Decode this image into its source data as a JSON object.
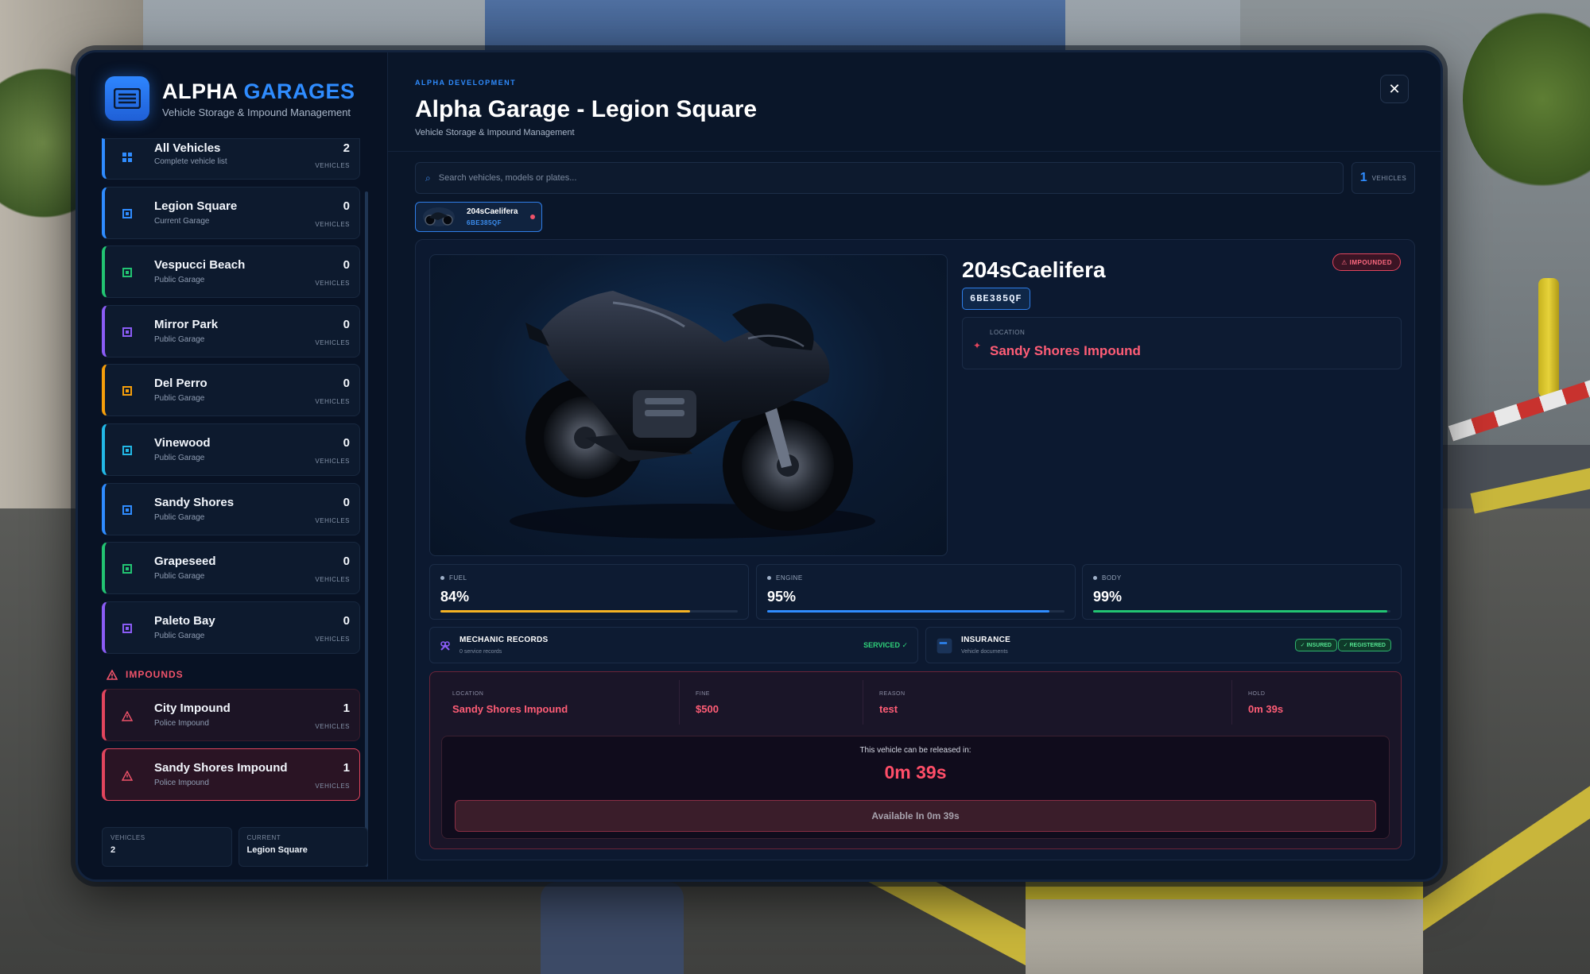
{
  "brand": {
    "title_main": "ALPHA",
    "title_accent": "GARAGES",
    "subtitle": "Vehicle Storage & Impound Management"
  },
  "sidebar": {
    "vehicles_unit": "VEHICLES",
    "garages": [
      {
        "name": "All Vehicles",
        "sub": "Complete vehicle list",
        "count": "2",
        "color": "#2f8cff"
      },
      {
        "name": "Legion Square",
        "sub": "Current Garage",
        "count": "0",
        "color": "#2f8cff"
      },
      {
        "name": "Vespucci Beach",
        "sub": "Public Garage",
        "count": "0",
        "color": "#22c472"
      },
      {
        "name": "Mirror Park",
        "sub": "Public Garage",
        "count": "0",
        "color": "#8b5cf6"
      },
      {
        "name": "Del Perro",
        "sub": "Public Garage",
        "count": "0",
        "color": "#f59e0b"
      },
      {
        "name": "Vinewood",
        "sub": "Public Garage",
        "count": "0",
        "color": "#22b8e6"
      },
      {
        "name": "Sandy Shores",
        "sub": "Public Garage",
        "count": "0",
        "color": "#2f8cff"
      },
      {
        "name": "Grapeseed",
        "sub": "Public Garage",
        "count": "0",
        "color": "#22c472"
      },
      {
        "name": "Paleto Bay",
        "sub": "Public Garage",
        "count": "0",
        "color": "#8b5cf6"
      }
    ],
    "impounds_heading": "IMPOUNDS",
    "impounds": [
      {
        "name": "City Impound",
        "sub": "Police Impound",
        "count": "1"
      },
      {
        "name": "Sandy Shores Impound",
        "sub": "Police Impound",
        "count": "1"
      }
    ],
    "footer": {
      "vehicles_label": "VEHICLES",
      "vehicles_value": "2",
      "current_label": "CURRENT",
      "current_value": "Legion Square"
    }
  },
  "main": {
    "kicker": "ALPHA DEVELOPMENT",
    "title": "Alpha Garage - Legion Square",
    "subtitle": "Vehicle Storage & Impound Management",
    "close_glyph": "✕",
    "search": {
      "placeholder": "Search vehicles, models or plates..."
    },
    "result_count": "1",
    "result_unit": "VEHICLES",
    "tab": {
      "name": "204sCaelifera",
      "plate": "6BE385QF"
    }
  },
  "vehicle": {
    "name": "204sCaelifera",
    "plate": "6BE385QF",
    "status_badge": "⚠ IMPOUNDED",
    "location_label": "LOCATION",
    "location_value": "Sandy Shores Impound",
    "stats": [
      {
        "label": "FUEL",
        "value": "84%",
        "fraction": 0.84,
        "color": "#f5b324"
      },
      {
        "label": "ENGINE",
        "value": "95%",
        "fraction": 0.95,
        "color": "#2f8cff"
      },
      {
        "label": "BODY",
        "value": "99%",
        "fraction": 0.99,
        "color": "#22c472"
      }
    ],
    "mechanic": {
      "title": "MECHANIC RECORDS",
      "sub": "0 service records",
      "status": "SERVICED ✓"
    },
    "insurance": {
      "title": "INSURANCE",
      "sub": "Vehicle documents",
      "tags": [
        "✓ INSURED",
        "✓ REGISTERED"
      ]
    }
  },
  "impound": {
    "location_label": "LOCATION",
    "location_value": "Sandy Shores Impound",
    "fine_label": "FINE",
    "fine_value": "$500",
    "reason_label": "REASON",
    "reason_value": "test",
    "hold_label": "HOLD",
    "hold_value": "0m 39s",
    "release_text": "This vehicle can be released in:",
    "release_time": "0m 39s",
    "release_button": "Available In 0m 39s"
  }
}
